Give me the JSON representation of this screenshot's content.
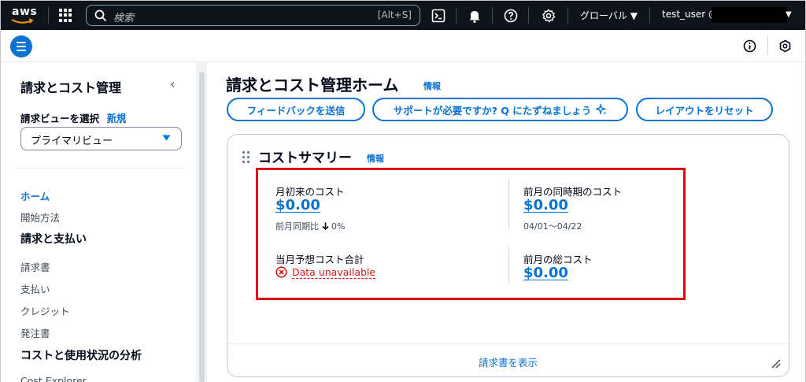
{
  "topnav": {
    "logo_text": "aws",
    "search_placeholder": "検索",
    "search_shortcut": "[Alt+S]",
    "region_label": "グローバル ▼",
    "user_label": "test_user @",
    "icons": [
      "services-grid-icon",
      "search-icon",
      "cloudshell-icon",
      "bell-icon",
      "help-icon",
      "settings-icon"
    ]
  },
  "subbar": {
    "icons": [
      "menu-icon",
      "info-icon",
      "hexagon-icon"
    ]
  },
  "sidebar": {
    "title": "請求とコスト管理",
    "view_label": "請求ビューを選択",
    "new_link": "新規",
    "select_value": "プライマリビュー",
    "items": [
      {
        "label": "ホーム",
        "active": true,
        "type": "item"
      },
      {
        "label": "開始方法",
        "type": "item"
      },
      {
        "label": "請求と支払い",
        "type": "heading"
      },
      {
        "label": "請求書",
        "type": "item"
      },
      {
        "label": "支払い",
        "type": "item"
      },
      {
        "label": "クレジット",
        "type": "item"
      },
      {
        "label": "発注書",
        "type": "item"
      },
      {
        "label": "コストと使用状況の分析",
        "type": "heading"
      },
      {
        "label": "Cost Explorer",
        "type": "item"
      }
    ]
  },
  "main": {
    "title": "請求とコスト管理ホーム",
    "title_info": "情報",
    "buttons": {
      "feedback": "フィードバックを送信",
      "support": "サポートが必要ですか? Q にたずねましょう",
      "reset_layout": "レイアウトをリセット"
    },
    "cost_summary": {
      "title": "コストサマリー",
      "info": "情報",
      "mtd_label": "月初来のコスト",
      "mtd_value": "$0.00",
      "mtd_compare": "前月同期比",
      "mtd_compare_value": "0%",
      "prev_same_period_label": "前月の同時期のコスト",
      "prev_same_period_value": "$0.00",
      "prev_same_period_range": "04/01〜04/22",
      "forecast_label": "当月予想コスト合計",
      "forecast_error": "Data unavailable",
      "prev_total_label": "前月の総コスト",
      "prev_total_value": "$0.00",
      "footer_link": "請求書を表示"
    }
  },
  "colors": {
    "nav_bg": "#0f141a",
    "link_blue": "#0972d3",
    "error_red": "#d91515",
    "highlight_red": "#e3000f"
  }
}
